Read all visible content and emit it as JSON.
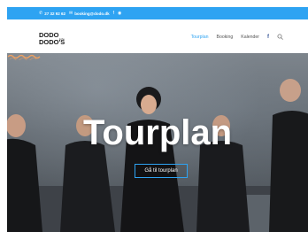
{
  "topbar": {
    "phone": "27 32 92 62",
    "email": "booking@dodo.dk",
    "icons": [
      "phone-icon",
      "envelope-icon",
      "facebook-icon",
      "rss-icon"
    ]
  },
  "logo": {
    "line1": "DODO",
    "small": "& the",
    "line2": "DODO'S"
  },
  "menu": {
    "items": [
      "Tourplan",
      "Booking",
      "Kalender"
    ],
    "active": "Tourplan",
    "facebook": "f",
    "search": "search-icon"
  },
  "hero": {
    "title": "Tourplan",
    "button": "Gå til tourplan"
  },
  "colors": {
    "accent": "#2ea3f2",
    "wave": "#f0a060"
  }
}
